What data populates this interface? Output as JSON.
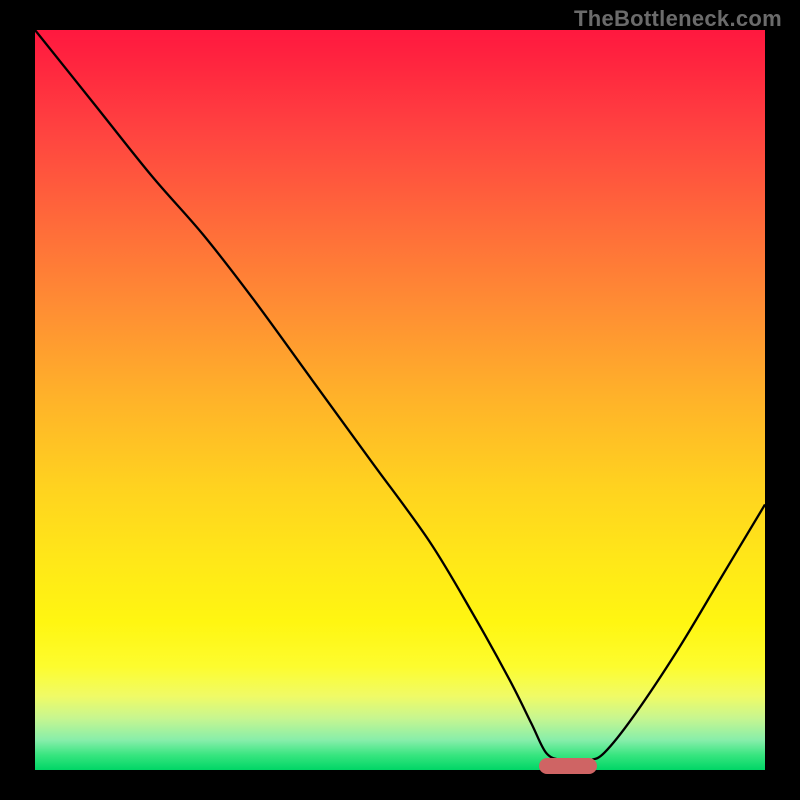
{
  "watermark": "TheBottleneck.com",
  "colors": {
    "frame_bg": "#000000",
    "marker": "#cf6464",
    "curve": "#000000"
  },
  "chart_data": {
    "type": "line",
    "title": "",
    "xlabel": "",
    "ylabel": "",
    "xlim": [
      0,
      100
    ],
    "ylim": [
      0,
      100
    ],
    "grid": false,
    "legend": false,
    "series": [
      {
        "name": "bottleneck-curve",
        "x": [
          0,
          8,
          16,
          23,
          30,
          38,
          46,
          54,
          60,
          65,
          68,
          70,
          72,
          74,
          76,
          78,
          82,
          88,
          94,
          100
        ],
        "y": [
          100,
          90,
          80,
          72,
          63,
          52,
          41,
          30,
          20,
          11,
          5,
          1,
          0,
          0,
          0,
          1,
          6,
          15,
          25,
          35
        ]
      }
    ],
    "marker": {
      "x": 73,
      "y": 0
    }
  }
}
